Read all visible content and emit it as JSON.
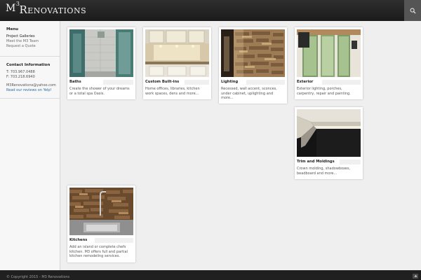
{
  "header": {
    "logo_m3": "M",
    "logo_sup": "3",
    "logo_renovations": "Renovations"
  },
  "icons": {
    "search": "search-icon",
    "to_top": "arrow-up-icon"
  },
  "sidebar": {
    "menu_title": "Menu",
    "menu_items": [
      {
        "label": "Project Galleries"
      },
      {
        "label": "Meet the M3 Team"
      },
      {
        "label": "Request a Quote"
      }
    ],
    "contact_title": "Contact Information",
    "phone": "T: 703.967.0488",
    "fax": "F: 703.218.6940",
    "email": "M3Renovations@yahoo.com",
    "yelp": "Read our reviews on Yelp!"
  },
  "galleries": [
    {
      "title": "Baths",
      "description": "Create the shower of your dreams or a total spa Oasis."
    },
    {
      "title": "Custom Built-ins",
      "description": "Home offices, libraries, kitchen work spaces, dens and more..."
    },
    {
      "title": "Lighting",
      "description": "Recessed, wall accent, sconces, under cabinet, uplighting and more..."
    },
    {
      "title": "Exterior",
      "description": "Exterior lighting, porches, carpentry, repair and painting."
    },
    {
      "title": "Trim and Moldings",
      "description": "Crown molding, shadowboxes, beadboard and more..."
    },
    {
      "title": "Kitchens",
      "description": "Add an island or complete chefs kitchen. M3 offers full and partial kitchen remodeling services."
    }
  ],
  "footer": {
    "copyright": "© Copyright 2015 - M3 Renovations"
  },
  "colors": {
    "header_bg": "#1b1b1b",
    "page_bg": "#efefef",
    "link_blue": "#2b6aa6"
  }
}
